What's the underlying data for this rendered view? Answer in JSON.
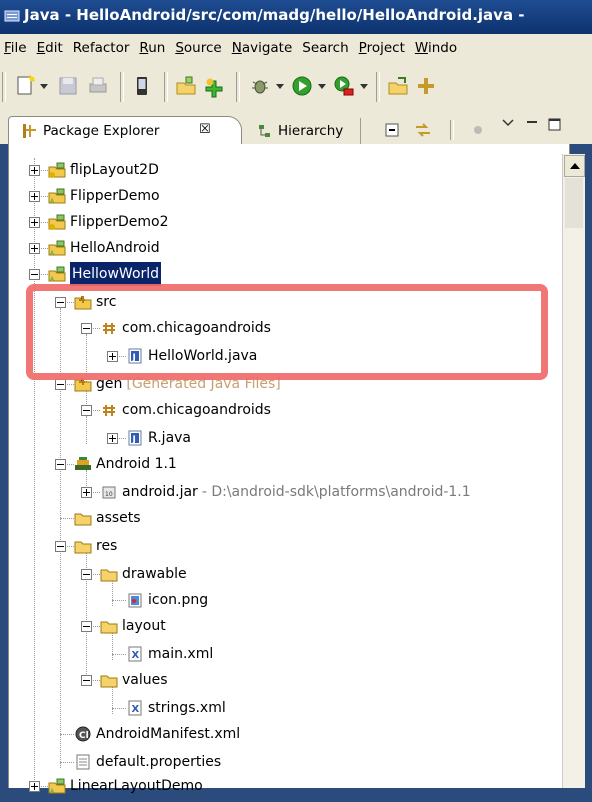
{
  "window": {
    "title": "Java - HelloAndroid/src/com/madg/hello/HelloAndroid.java - "
  },
  "menu": {
    "items": [
      {
        "first": "F",
        "rest": "ile"
      },
      {
        "first": "E",
        "rest": "dit"
      },
      {
        "first": "",
        "rest": "Refactor"
      },
      {
        "first": "R",
        "rest": "un"
      },
      {
        "first": "S",
        "rest": "ource"
      },
      {
        "first": "N",
        "rest": "avigate"
      },
      {
        "first": "",
        "rest": "Search"
      },
      {
        "first": "P",
        "rest": "roject"
      },
      {
        "first": "W",
        "rest": "indo"
      }
    ]
  },
  "tabs": {
    "package_explorer": "Package Explorer",
    "close_glyph": "☒",
    "hierarchy": "Hierarchy"
  },
  "tree": {
    "projects_top": [
      "flipLayout2D",
      "FlipperDemo",
      "FlipperDemo2",
      "HelloAndroid"
    ],
    "selected_project": "HellowWorld",
    "src": "src",
    "src_package": "com.chicagoandroids",
    "src_file": "HelloWorld.java",
    "gen": "gen",
    "gen_decoration": "[Generated Java Files]",
    "gen_package": "com.chicagoandroids",
    "gen_file": "R.java",
    "android_lib": "Android 1.1",
    "android_jar": "android.jar",
    "android_jar_path": " - D:\\android-sdk\\platforms\\android-1.1",
    "assets": "assets",
    "res": "res",
    "drawable": "drawable",
    "icon_file": "icon.png",
    "layout": "layout",
    "main_xml": "main.xml",
    "values": "values",
    "strings_xml": "strings.xml",
    "manifest": "AndroidManifest.xml",
    "default_properties": "default.properties",
    "next_project": "LinearLayoutDemo"
  },
  "colors": {
    "highlight": "#f06a6a",
    "selection": "#0a246a",
    "titlebar": "#1f4d92"
  }
}
